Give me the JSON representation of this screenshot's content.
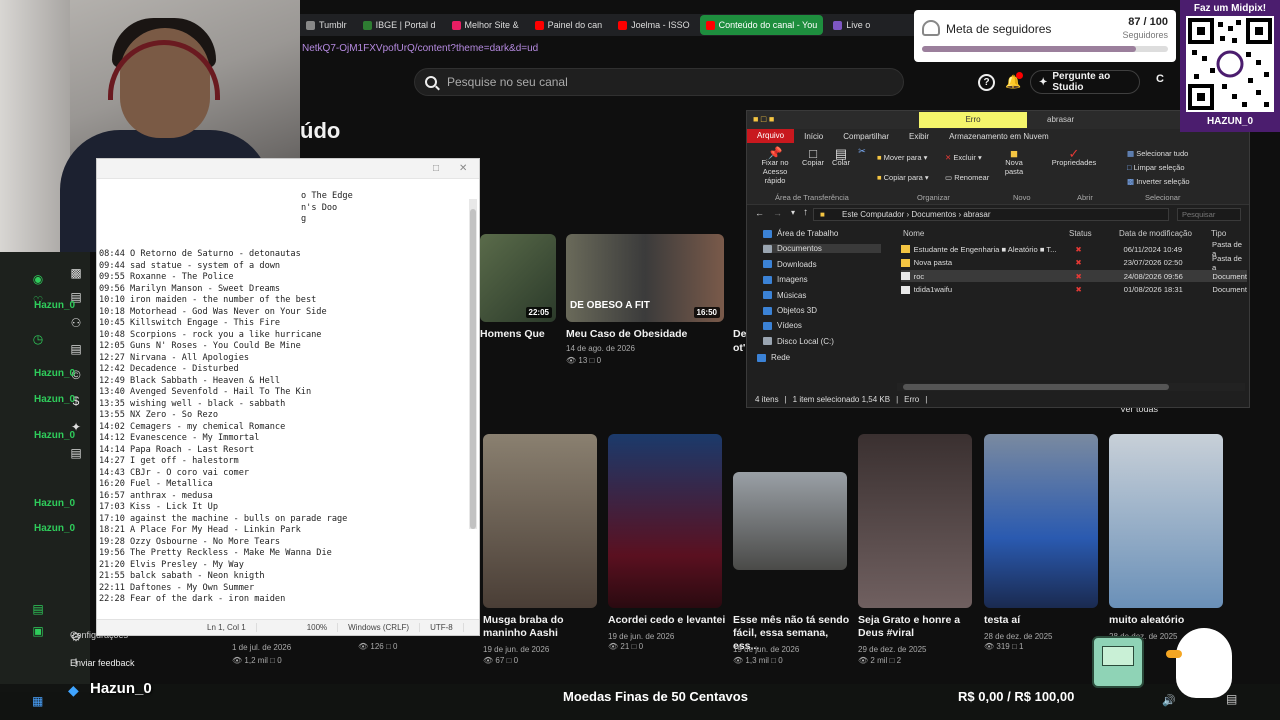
{
  "browser": {
    "tabs": [
      {
        "label": "Tumblr",
        "color": "#888888"
      },
      {
        "label": "IBGE | Portal d",
        "color": "#2e7d32"
      },
      {
        "label": "Melhor Site &",
        "color": "#e91e63"
      },
      {
        "label": "Painel do can",
        "color": "#ff0000"
      },
      {
        "label": "Joelma - ISSO",
        "color": "#ff0000"
      },
      {
        "label": "Conteúdo do canal - You",
        "color": "#ff0000",
        "active": true
      },
      {
        "label": "Live o",
        "color": "#7e57c2"
      }
    ],
    "url": "NetkQ7-OjM1FXVpofUrQ/content?theme=dark&d=ud"
  },
  "studio": {
    "search_placeholder": "Pesquise no seu canal",
    "ask_studio": "Pergunte ao Studio",
    "create": "C",
    "page_title": "údo",
    "ver_todas": "Ver todas",
    "settings": "Configurações",
    "feedback": "Enviar feedback"
  },
  "videos_top": [
    {
      "title": "Homens Que",
      "duration": "22:05"
    },
    {
      "title": "Meu Caso de Obesidade",
      "date": "14 de ago. de 2026",
      "views": "13",
      "comments": "0",
      "duration": "16:50",
      "overlay": "DE OBESO A FIT"
    },
    {
      "title": "Dev",
      "sub": "ot'i"
    }
  ],
  "videos_bottom": [
    {
      "title": "Musga braba do maninho Aashi",
      "date": "19 de jun. de 2026",
      "views": "67",
      "comments": "0"
    },
    {
      "title": "Acordei cedo e levantei",
      "date": "19 de jun. de 2026",
      "views": "21",
      "comments": "0"
    },
    {
      "title": "Esse mês não tá sendo fácil, essa semana, ess...",
      "date": "19 de jun. de 2026",
      "views": "1,3 mil",
      "comments": "0"
    },
    {
      "title": "Seja Grato e honre a Deus #viral",
      "date": "29 de dez. de 2025",
      "views": "2 mil",
      "comments": "2"
    },
    {
      "title": "testa aí",
      "date": "28 de dez. de 2025",
      "views": "319",
      "comments": "1"
    },
    {
      "title": "muito aleatório",
      "date": "28 de dez. de 2025",
      "views": "",
      "comments": "7"
    }
  ],
  "left_stats": [
    {
      "date": "1 de jul. de 2026",
      "views": "1,2 mil",
      "comments": "0"
    },
    {
      "views": "126",
      "comments": "0"
    }
  ],
  "notepad": {
    "top_lines": [
      "o The Edge",
      "n's Doo",
      "",
      "",
      "g"
    ],
    "lines": [
      "08:44 O Retorno de Saturno - detonautas",
      "09:44 sad statue - system of a down",
      "09:55 Roxanne - The Police",
      "09:56 Marilyn Manson - Sweet Dreams",
      "10:10 iron maiden - the number of the best",
      "10:18 Motorhead - God Was Never on Your Side",
      "10:45 Killswitch Engage - This Fire",
      "10:48 Scorpions - rock you a like hurricane",
      "12:05 Guns N' Roses - You Could Be Mine",
      "12:27 Nirvana - All Apologies",
      "12:42 Decadence - Disturbed",
      "12:49 Black Sabbath - Heaven & Hell",
      "13:40 Avenged Sevenfold - Hail To The Kin",
      "13:35 wishing well - black - sabbath",
      "13:55 NX Zero - So Rezo",
      "14:02 Cemagers - my chemical Romance",
      "14:12 Evanescence - My Immortal",
      "14:14 Papa Roach - Last Resort",
      "14:27 I get off - halestorm",
      "14:43 CBJr - O coro vai comer",
      "16:20 Fuel - Metallica",
      "16:57 anthrax - medusa",
      "17:03 Kiss - Lick It Up",
      "17:10 against the machine - bulls on parade rage",
      "18:21 A Place For My Head - Linkin Park",
      "19:28 Ozzy Osbourne - No More Tears",
      "19:56 The Pretty Reckless - Make Me Wanna Die",
      "21:20 Elvis Presley - My Way",
      "21:55 balck sabath - Neon knigth",
      "22:11 Daftones - My Own Summer",
      "22:28 Fear of the dark - iron maiden"
    ],
    "status": {
      "position": "Ln 1, Col 1",
      "zoom": "100%",
      "eol": "Windows (CRLF)",
      "encoding": "UTF-8"
    }
  },
  "explorer": {
    "title_error": "Erro",
    "title_folder": "abrasar",
    "menu": [
      "Arquivo",
      "Início",
      "Compartilhar",
      "Exibir",
      "Armazenamento em Nuvem"
    ],
    "ribbon": {
      "pin": "Fixar no Acesso rápido",
      "copy": "Copiar",
      "paste": "Colar",
      "move_to": "Mover para",
      "copy_to": "Copiar para",
      "delete": "Excluir",
      "rename": "Renomear",
      "new_folder": "Nova pasta",
      "properties": "Propriedades",
      "select_all": "Selecionar tudo",
      "select_none": "Limpar seleção",
      "invert": "Inverter seleção",
      "groups": [
        "Área de Transferência",
        "Organizar",
        "Novo",
        "Abrir",
        "Selecionar"
      ]
    },
    "breadcrumb": [
      "Este Computador",
      "Documentos",
      "abrasar"
    ],
    "search_placeholder": "Pesquisar",
    "nav": [
      {
        "label": "Área de Trabalho",
        "color": "#3b82d6"
      },
      {
        "label": "Documentos",
        "color": "#9aa5b1",
        "selected": true
      },
      {
        "label": "Downloads",
        "color": "#3b82d6"
      },
      {
        "label": "Imagens",
        "color": "#3b82d6"
      },
      {
        "label": "Músicas",
        "color": "#3b82d6"
      },
      {
        "label": "Objetos 3D",
        "color": "#3b82d6"
      },
      {
        "label": "Vídeos",
        "color": "#3b82d6"
      },
      {
        "label": "Disco Local (C:)",
        "color": "#9aa5b1"
      },
      {
        "label": "Rede",
        "color": "#3b82d6"
      }
    ],
    "columns": [
      "Nome",
      "Status",
      "Data de modificação",
      "Tipo"
    ],
    "files": [
      {
        "name": "Estudante de Engenharia ■ Aleatório ■ T...",
        "date": "06/11/2024 10:49",
        "type": "Pasta de a",
        "folder": true
      },
      {
        "name": "Nova pasta",
        "date": "23/07/2026 02:50",
        "type": "Pasta de a",
        "folder": true
      },
      {
        "name": "roc",
        "date": "24/08/2026 09:56",
        "type": "Document",
        "folder": false,
        "selected": true
      },
      {
        "name": "tdida1waifu",
        "date": "01/08/2026 18:31",
        "type": "Document",
        "folder": false
      }
    ],
    "status": {
      "items": "4 itens",
      "selected": "1 item selecionado 1,54 KB",
      "error": "Erro"
    }
  },
  "goal": {
    "label": "Meta de seguidores",
    "current": "87 / 100",
    "sub": "Seguidores",
    "progress": 0.87
  },
  "qr": {
    "header": "Faz um Midpix!",
    "footer": "HAZUN_0"
  },
  "chat_names": [
    "Hazun_0",
    "Hazun_0",
    "Hazun_0",
    "Hazun_0",
    "Hazun_0",
    "Hazun_0"
  ],
  "footer": {
    "twitter": "Hazun_0",
    "marquee": "Moedas Finas de 50 Centavos",
    "money": "R$ 0,00 / R$ 100,00"
  },
  "colors": {
    "accent_red": "#c8181e",
    "chat_green": "#2fcc5b",
    "qr_purple": "#4b1d6e"
  }
}
